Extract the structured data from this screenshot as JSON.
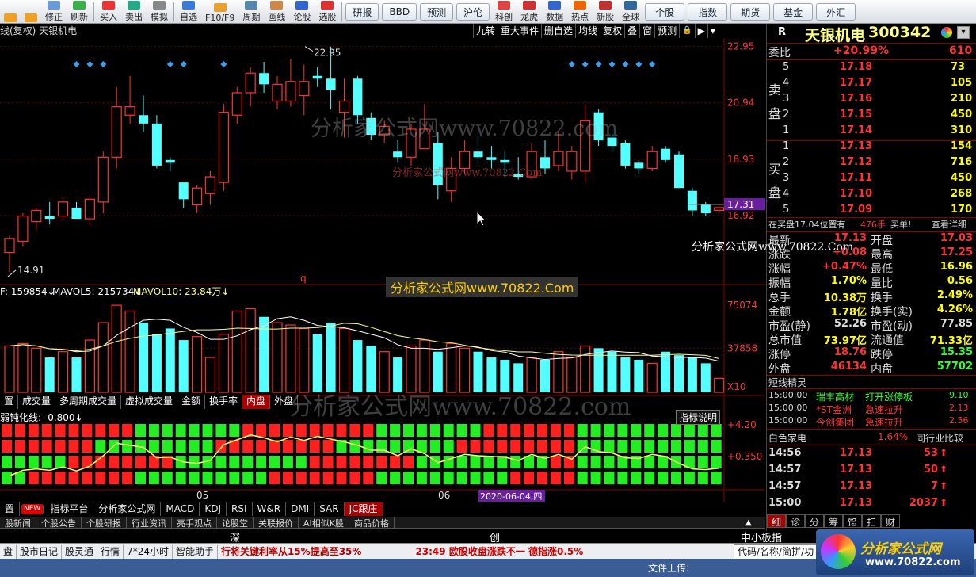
{
  "toolbar": {
    "left": [
      {
        "label": "",
        "name": "back-button",
        "color": "#f0a020"
      },
      {
        "label": "",
        "name": "forward-button",
        "color": "#f0a020"
      },
      {
        "label": "修正",
        "name": "edit-button",
        "color": "#6a9bd8"
      },
      {
        "label": "刷新",
        "name": "refresh-button",
        "color": "#3bb04a"
      },
      {
        "label": "买入",
        "name": "buy-button",
        "color": "#e33"
      },
      {
        "label": "卖出",
        "name": "sell-button",
        "color": "#2a8"
      },
      {
        "label": "模拟",
        "name": "simulate-button",
        "color": "#888"
      },
      {
        "label": "自选",
        "name": "watchlist-button",
        "color": "#3b7ad8"
      },
      {
        "label": "F10/F9",
        "name": "f10-button",
        "color": "#e8a030"
      },
      {
        "label": "周期",
        "name": "period-button",
        "color": "#58a"
      },
      {
        "label": "画线",
        "name": "draw-line-button",
        "color": "#c84"
      },
      {
        "label": "论股",
        "name": "forum-button",
        "color": "#36c"
      },
      {
        "label": "选股",
        "name": "stock-picker-button",
        "color": "#d33"
      }
    ],
    "boxes": [
      "研报",
      "BBD",
      "预测",
      "沪伦"
    ],
    "right": [
      {
        "label": "科创",
        "name": "star-market-button",
        "color": "#d44"
      },
      {
        "label": "龙虎",
        "name": "dragon-tiger-button",
        "color": "#c33"
      },
      {
        "label": "数据",
        "name": "data-button",
        "color": "#36c"
      },
      {
        "label": "热点",
        "name": "hotspot-button",
        "color": "#e60"
      },
      {
        "label": "新股",
        "name": "new-stock-button",
        "color": "#b33"
      },
      {
        "label": "全球",
        "name": "global-button",
        "color": "#369"
      }
    ],
    "boxes2": [
      "个股",
      "指数",
      "期货",
      "基金",
      "外汇"
    ]
  },
  "chart": {
    "title": "线(复权) 天银机电",
    "tools": [
      "九转",
      "重大事件",
      "删自选",
      "均线",
      "复权",
      "叠",
      "窗",
      "预测"
    ],
    "price_axis": [
      "22.95",
      "20.94",
      "18.93",
      "16.92"
    ],
    "current_price_tag": "17.31",
    "high_label": "22.95",
    "low_label": "14.91",
    "vol_axis": [
      "75074",
      "37858",
      "X10"
    ],
    "vol_legend": {
      "a": "F: 159854↓",
      "b": "MAVOL5: 215734↓",
      "c": "MAVOL10: 23.84万↓"
    },
    "ind_legend": "弱钝化线: -0.800↓",
    "ind_axis": [
      "+4.20",
      "+0.350"
    ],
    "ind_button": "指标说明",
    "x_labels": [
      "05",
      "06"
    ],
    "date_tag": "2020-06-04,四",
    "q_label": "q"
  },
  "chart_data": {
    "type": "candlestick",
    "ylim": [
      14.91,
      22.95
    ],
    "candles": [
      {
        "o": 15.6,
        "h": 16.2,
        "l": 14.9,
        "c": 16.1,
        "up": true
      },
      {
        "o": 16.0,
        "h": 17.0,
        "l": 15.8,
        "c": 16.9,
        "up": true
      },
      {
        "o": 16.7,
        "h": 17.2,
        "l": 16.4,
        "c": 17.1,
        "up": true
      },
      {
        "o": 16.8,
        "h": 17.4,
        "l": 16.6,
        "c": 16.9,
        "up": false
      },
      {
        "o": 16.9,
        "h": 17.6,
        "l": 16.7,
        "c": 17.4,
        "up": true
      },
      {
        "o": 17.2,
        "h": 17.4,
        "l": 16.8,
        "c": 16.8,
        "up": false
      },
      {
        "o": 16.8,
        "h": 17.6,
        "l": 16.6,
        "c": 17.5,
        "up": true
      },
      {
        "o": 17.4,
        "h": 19.2,
        "l": 17.0,
        "c": 19.0,
        "up": true
      },
      {
        "o": 19.0,
        "h": 21.5,
        "l": 18.6,
        "c": 20.8,
        "up": true
      },
      {
        "o": 20.8,
        "h": 21.9,
        "l": 20.2,
        "c": 20.5,
        "up": true
      },
      {
        "o": 20.5,
        "h": 21.2,
        "l": 19.9,
        "c": 20.2,
        "up": false
      },
      {
        "o": 20.2,
        "h": 20.5,
        "l": 18.6,
        "c": 18.7,
        "up": false
      },
      {
        "o": 18.9,
        "h": 19.0,
        "l": 18.5,
        "c": 18.8,
        "up": false
      },
      {
        "o": 17.5,
        "h": 18.0,
        "l": 17.2,
        "c": 18.1,
        "up": false
      },
      {
        "o": 17.3,
        "h": 18.0,
        "l": 17.0,
        "c": 17.9,
        "up": true
      },
      {
        "o": 17.7,
        "h": 18.5,
        "l": 17.3,
        "c": 18.3,
        "up": true
      },
      {
        "o": 18.1,
        "h": 20.9,
        "l": 17.8,
        "c": 20.6,
        "up": true
      },
      {
        "o": 20.5,
        "h": 21.5,
        "l": 20.2,
        "c": 21.3,
        "up": true
      },
      {
        "o": 21.3,
        "h": 22.2,
        "l": 20.8,
        "c": 22.0,
        "up": true
      },
      {
        "o": 22.0,
        "h": 22.4,
        "l": 21.3,
        "c": 21.6,
        "up": false
      },
      {
        "o": 21.6,
        "h": 21.9,
        "l": 20.7,
        "c": 21.0,
        "up": true
      },
      {
        "o": 21.0,
        "h": 22.5,
        "l": 20.8,
        "c": 21.7,
        "up": true
      },
      {
        "o": 21.7,
        "h": 22.3,
        "l": 20.5,
        "c": 21.2,
        "up": true
      },
      {
        "o": 21.9,
        "h": 22.2,
        "l": 21.5,
        "c": 21.8,
        "up": false
      },
      {
        "o": 21.8,
        "h": 22.95,
        "l": 20.7,
        "c": 21.4,
        "up": false
      },
      {
        "o": 20.6,
        "h": 21.8,
        "l": 19.7,
        "c": 21.0,
        "up": true
      },
      {
        "o": 21.8,
        "h": 21.9,
        "l": 20.2,
        "c": 20.5,
        "up": false
      },
      {
        "o": 20.4,
        "h": 20.6,
        "l": 19.6,
        "c": 19.8,
        "up": false
      },
      {
        "o": 20.1,
        "h": 20.3,
        "l": 19.5,
        "c": 19.8,
        "up": true
      },
      {
        "o": 19.2,
        "h": 19.6,
        "l": 18.8,
        "c": 19.0,
        "up": false
      },
      {
        "o": 19.0,
        "h": 20.2,
        "l": 18.7,
        "c": 20.0,
        "up": true
      },
      {
        "o": 20.0,
        "h": 20.9,
        "l": 19.3,
        "c": 19.3,
        "up": true
      },
      {
        "o": 19.5,
        "h": 19.9,
        "l": 17.5,
        "c": 18.0,
        "up": false
      },
      {
        "o": 17.8,
        "h": 19.0,
        "l": 17.4,
        "c": 18.6,
        "up": true
      },
      {
        "o": 18.6,
        "h": 19.6,
        "l": 18.4,
        "c": 19.2,
        "up": true
      },
      {
        "o": 19.2,
        "h": 19.8,
        "l": 18.7,
        "c": 19.0,
        "up": false
      },
      {
        "o": 19.0,
        "h": 19.4,
        "l": 18.6,
        "c": 18.9,
        "up": false
      },
      {
        "o": 18.9,
        "h": 19.2,
        "l": 18.3,
        "c": 18.8,
        "up": false
      },
      {
        "o": 18.4,
        "h": 19.0,
        "l": 18.2,
        "c": 18.3,
        "up": false
      },
      {
        "o": 18.3,
        "h": 19.5,
        "l": 18.2,
        "c": 19.2,
        "up": true
      },
      {
        "o": 19.0,
        "h": 19.6,
        "l": 18.4,
        "c": 18.6,
        "up": false
      },
      {
        "o": 18.7,
        "h": 19.9,
        "l": 18.5,
        "c": 19.2,
        "up": true
      },
      {
        "o": 19.2,
        "h": 19.4,
        "l": 18.2,
        "c": 18.5,
        "up": true
      },
      {
        "o": 18.5,
        "h": 20.9,
        "l": 18.1,
        "c": 20.3,
        "up": true
      },
      {
        "o": 20.6,
        "h": 20.7,
        "l": 19.4,
        "c": 19.6,
        "up": false
      },
      {
        "o": 19.7,
        "h": 19.9,
        "l": 19.2,
        "c": 19.4,
        "up": false
      },
      {
        "o": 19.5,
        "h": 19.6,
        "l": 18.6,
        "c": 18.7,
        "up": false
      },
      {
        "o": 18.8,
        "h": 18.9,
        "l": 18.4,
        "c": 18.6,
        "up": false
      },
      {
        "o": 18.6,
        "h": 19.4,
        "l": 18.5,
        "c": 19.2,
        "up": true
      },
      {
        "o": 19.3,
        "h": 19.4,
        "l": 18.8,
        "c": 18.9,
        "up": false
      },
      {
        "o": 19.1,
        "h": 19.2,
        "l": 17.9,
        "c": 17.9,
        "up": false
      },
      {
        "o": 17.8,
        "h": 17.9,
        "l": 16.9,
        "c": 17.1,
        "up": false
      },
      {
        "o": 17.3,
        "h": 17.4,
        "l": 16.9,
        "c": 17.0,
        "up": false
      },
      {
        "o": 17.1,
        "h": 17.3,
        "l": 17.0,
        "c": 17.2,
        "up": true
      }
    ],
    "volume_ylim": [
      0,
      75074
    ],
    "volumes": [
      40000,
      42000,
      38000,
      30000,
      35000,
      30000,
      45000,
      60000,
      75000,
      70000,
      60000,
      50000,
      55000,
      45000,
      48000,
      30000,
      50000,
      70000,
      72000,
      65000,
      60000,
      58000,
      55000,
      50000,
      60000,
      55000,
      45000,
      40000,
      35000,
      30000,
      40000,
      45000,
      35000,
      42000,
      38000,
      35000,
      30000,
      28000,
      25000,
      30000,
      28000,
      35000,
      30000,
      40000,
      38000,
      35000,
      30000,
      28000,
      25000,
      35000,
      32000,
      30000,
      25000,
      12000
    ],
    "volume_up": [
      true,
      true,
      true,
      false,
      true,
      false,
      true,
      true,
      true,
      true,
      false,
      false,
      false,
      false,
      true,
      true,
      true,
      true,
      true,
      false,
      true,
      true,
      true,
      false,
      false,
      true,
      false,
      false,
      true,
      false,
      true,
      true,
      false,
      true,
      true,
      false,
      false,
      false,
      false,
      true,
      false,
      true,
      true,
      true,
      false,
      false,
      false,
      false,
      true,
      false,
      false,
      false,
      false,
      true
    ]
  },
  "quote": {
    "code_letter": "R",
    "name": "天银机电",
    "code": "300342",
    "weibi_label": "委比",
    "weibi_value": "+20.99%",
    "weibi_diff": "610",
    "sell_label": [
      "卖",
      "盘"
    ],
    "buy_label": [
      "买",
      "盘"
    ],
    "asks": [
      {
        "n": "5",
        "p": "17.18",
        "v": "73"
      },
      {
        "n": "4",
        "p": "17.17",
        "v": "105"
      },
      {
        "n": "3",
        "p": "17.16",
        "v": "210"
      },
      {
        "n": "2",
        "p": "17.15",
        "v": "450"
      },
      {
        "n": "1",
        "p": "17.14",
        "v": "310"
      }
    ],
    "bids": [
      {
        "n": "1",
        "p": "17.13",
        "v": "154"
      },
      {
        "n": "2",
        "p": "17.12",
        "v": "716"
      },
      {
        "n": "3",
        "p": "17.11",
        "v": "450"
      },
      {
        "n": "4",
        "p": "17.10",
        "v": "268"
      },
      {
        "n": "5",
        "p": "17.09",
        "v": "170"
      }
    ],
    "notice": {
      "a": "在买盘17.04位置有",
      "b": "476手",
      "c": "买单!",
      "d": "查看详细"
    },
    "stats": [
      {
        "l": "最新",
        "v": "17.13",
        "l2": "开盘",
        "v2": "17.03",
        "c": "#f33",
        "c2": "#f33"
      },
      {
        "l": "涨跌",
        "v": "+0.08",
        "l2": "最高",
        "v2": "17.25",
        "c": "#f33",
        "c2": "#f33"
      },
      {
        "l": "涨幅",
        "v": "+0.47%",
        "l2": "最低",
        "v2": "16.96",
        "c": "#f33",
        "c2": "#ff0"
      },
      {
        "l": "振幅",
        "v": "1.70%",
        "l2": "量比",
        "v2": "0.56",
        "c": "#ff0",
        "c2": "#ff0"
      },
      {
        "l": "总手",
        "v": "10.38万",
        "l2": "换手",
        "v2": "2.49%",
        "c": "#ff0",
        "c2": "#ff0"
      },
      {
        "l": "金额",
        "v": "1.78亿",
        "l2": "换手(实)",
        "v2": "4.26%",
        "c": "#ff0",
        "c2": "#ff0"
      },
      {
        "l": "市盈(静)",
        "v": "52.26",
        "l2": "市盈(动)",
        "v2": "77.85",
        "c": "#ddd",
        "c2": "#ddd"
      },
      {
        "l": "总市值",
        "v": "73.97亿",
        "l2": "流通值",
        "v2": "71.33亿",
        "c": "#ff0",
        "c2": "#ff0"
      },
      {
        "l": "涨停",
        "v": "18.76",
        "l2": "跌停",
        "v2": "15.35",
        "c": "#f33",
        "c2": "#3f3"
      },
      {
        "l": "外盘",
        "v": "46134",
        "l2": "内盘",
        "v2": "57702",
        "c": "#f33",
        "c2": "#3f3"
      }
    ],
    "sprite_title": "短线精灵",
    "sprites": [
      {
        "t": "15:00:00",
        "n": "瑞丰高材",
        "a": "打开涨停板",
        "v": "9.10",
        "nc": "#3f3",
        "ac": "#3f3"
      },
      {
        "t": "15:00:00",
        "n": "*ST金洲",
        "a": "急速拉升",
        "v": "2.13",
        "nc": "#f33",
        "ac": "#f33"
      },
      {
        "t": "15:00:00",
        "n": "今创集团",
        "a": "急速拉升",
        "v": "2.56",
        "nc": "#f33",
        "ac": "#f33"
      }
    ],
    "sector": {
      "a": "白色家电",
      "b": "1.64%",
      "c": "同行业比较"
    },
    "ticks": [
      {
        "t": "14:56",
        "p": "17.13",
        "v": "53"
      },
      {
        "t": "14:57",
        "p": "17.13",
        "v": "50"
      },
      {
        "t": "14:57",
        "p": "17.13",
        "v": "7"
      },
      {
        "t": "15:00",
        "p": "17.13",
        "v": "2037"
      }
    ],
    "right_tabs": [
      "细",
      "诊",
      "分",
      "筹",
      "馅",
      "扫",
      "财"
    ]
  },
  "vol_tabs": [
    "置",
    "成交量",
    "多周期成交量",
    "虚拟成交量",
    "金额",
    "换手率",
    "内盘",
    "外盘"
  ],
  "bottom_tabs": [
    "置",
    "NEW",
    "指标平台",
    "分析家公式网",
    "MACD",
    "KDJ",
    "RSI",
    "W&R",
    "DMI",
    "SAR",
    "JC跟庄"
  ],
  "news_tabs": [
    "股新闻",
    "个股公告",
    "个股研报",
    "行业资讯",
    "亮手观点",
    "论股堂",
    "关联报价",
    "AI相似K股",
    "商品价格"
  ],
  "mid_bar": {
    "a": "深",
    "b": "创",
    "c": "中小板指"
  },
  "status": {
    "items": [
      "盘",
      "股市日记",
      "股灵通",
      "行情",
      "7*24小时",
      "智能助手"
    ],
    "news1": "行将关键利率从15%提高至35%",
    "news2": "23:49 欧股收盘涨跌不一 德指涨0.5%",
    "right": "代码/名称/简拼/功"
  },
  "upload_label": "文件上传:",
  "watermarks": {
    "a": "分析家公式网www.70822.com",
    "b": "分析家公式网www.70822.Com",
    "c": "分析家公式网www.70822.Com",
    "d": "分析家公式网www.70822.Com",
    "e": "分析家公式网www.70822.com"
  },
  "logo": {
    "a": "分析家公式网",
    "b": "www.70822.com"
  },
  "colors": {
    "up": "#ff3232",
    "down": "#54ffff",
    "ma": "#ffff7f",
    "grid": "#8b0000"
  }
}
